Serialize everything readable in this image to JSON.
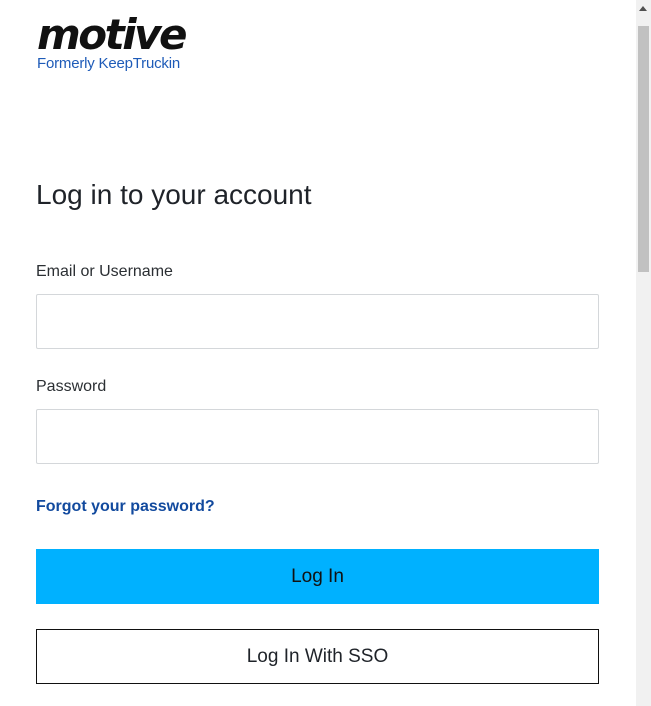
{
  "brand": {
    "name": "motive",
    "tagline": "Formerly KeepTruckin"
  },
  "login": {
    "title": "Log in to your account",
    "email_label": "Email or Username",
    "email_value": "",
    "password_label": "Password",
    "password_value": "",
    "forgot_link": "Forgot your password?",
    "login_button": "Log In",
    "sso_button": "Log In With SSO"
  },
  "colors": {
    "primary_button": "#00b1ff",
    "link": "#124a9e",
    "brand_subtitle": "#1e5bb8"
  },
  "icons": {
    "scroll_up": "up-arrow-icon"
  }
}
